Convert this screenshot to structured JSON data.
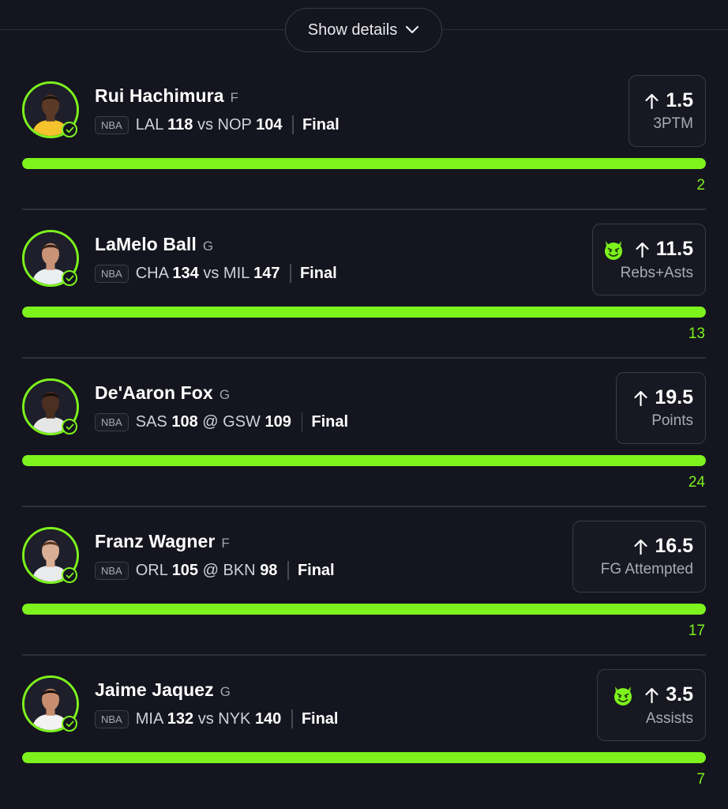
{
  "header": {
    "details_label": "Show details"
  },
  "colors": {
    "accent": "#7df21d",
    "background": "#14151e"
  },
  "picks": [
    {
      "name": "Rui Hachimura",
      "position": "F",
      "league": "NBA",
      "away_team": "LAL",
      "away_score": "118",
      "connector": "vs",
      "home_team": "NOP",
      "home_score": "104",
      "status": "Final",
      "line": "1.5",
      "direction": "up",
      "stat": "3PTM",
      "result": "2",
      "progress": 1.0,
      "demon": false
    },
    {
      "name": "LaMelo Ball",
      "position": "G",
      "league": "NBA",
      "away_team": "CHA",
      "away_score": "134",
      "connector": "vs",
      "home_team": "MIL",
      "home_score": "147",
      "status": "Final",
      "line": "11.5",
      "direction": "up",
      "stat": "Rebs+Asts",
      "result": "13",
      "progress": 1.0,
      "demon": true
    },
    {
      "name": "De'Aaron Fox",
      "position": "G",
      "league": "NBA",
      "away_team": "SAS",
      "away_score": "108",
      "connector": "@",
      "home_team": "GSW",
      "home_score": "109",
      "status": "Final",
      "line": "19.5",
      "direction": "up",
      "stat": "Points",
      "result": "24",
      "progress": 1.0,
      "demon": false
    },
    {
      "name": "Franz Wagner",
      "position": "F",
      "league": "NBA",
      "away_team": "ORL",
      "away_score": "105",
      "connector": "@",
      "home_team": "BKN",
      "home_score": "98",
      "status": "Final",
      "line": "16.5",
      "direction": "up",
      "stat": "FG Attempted",
      "result": "17",
      "progress": 1.0,
      "demon": false
    },
    {
      "name": "Jaime Jaquez",
      "position": "G",
      "league": "NBA",
      "away_team": "MIA",
      "away_score": "132",
      "connector": "vs",
      "home_team": "NYK",
      "home_score": "140",
      "status": "Final",
      "line": "3.5",
      "direction": "up",
      "stat": "Assists",
      "result": "7",
      "progress": 1.0,
      "demon": true
    }
  ]
}
